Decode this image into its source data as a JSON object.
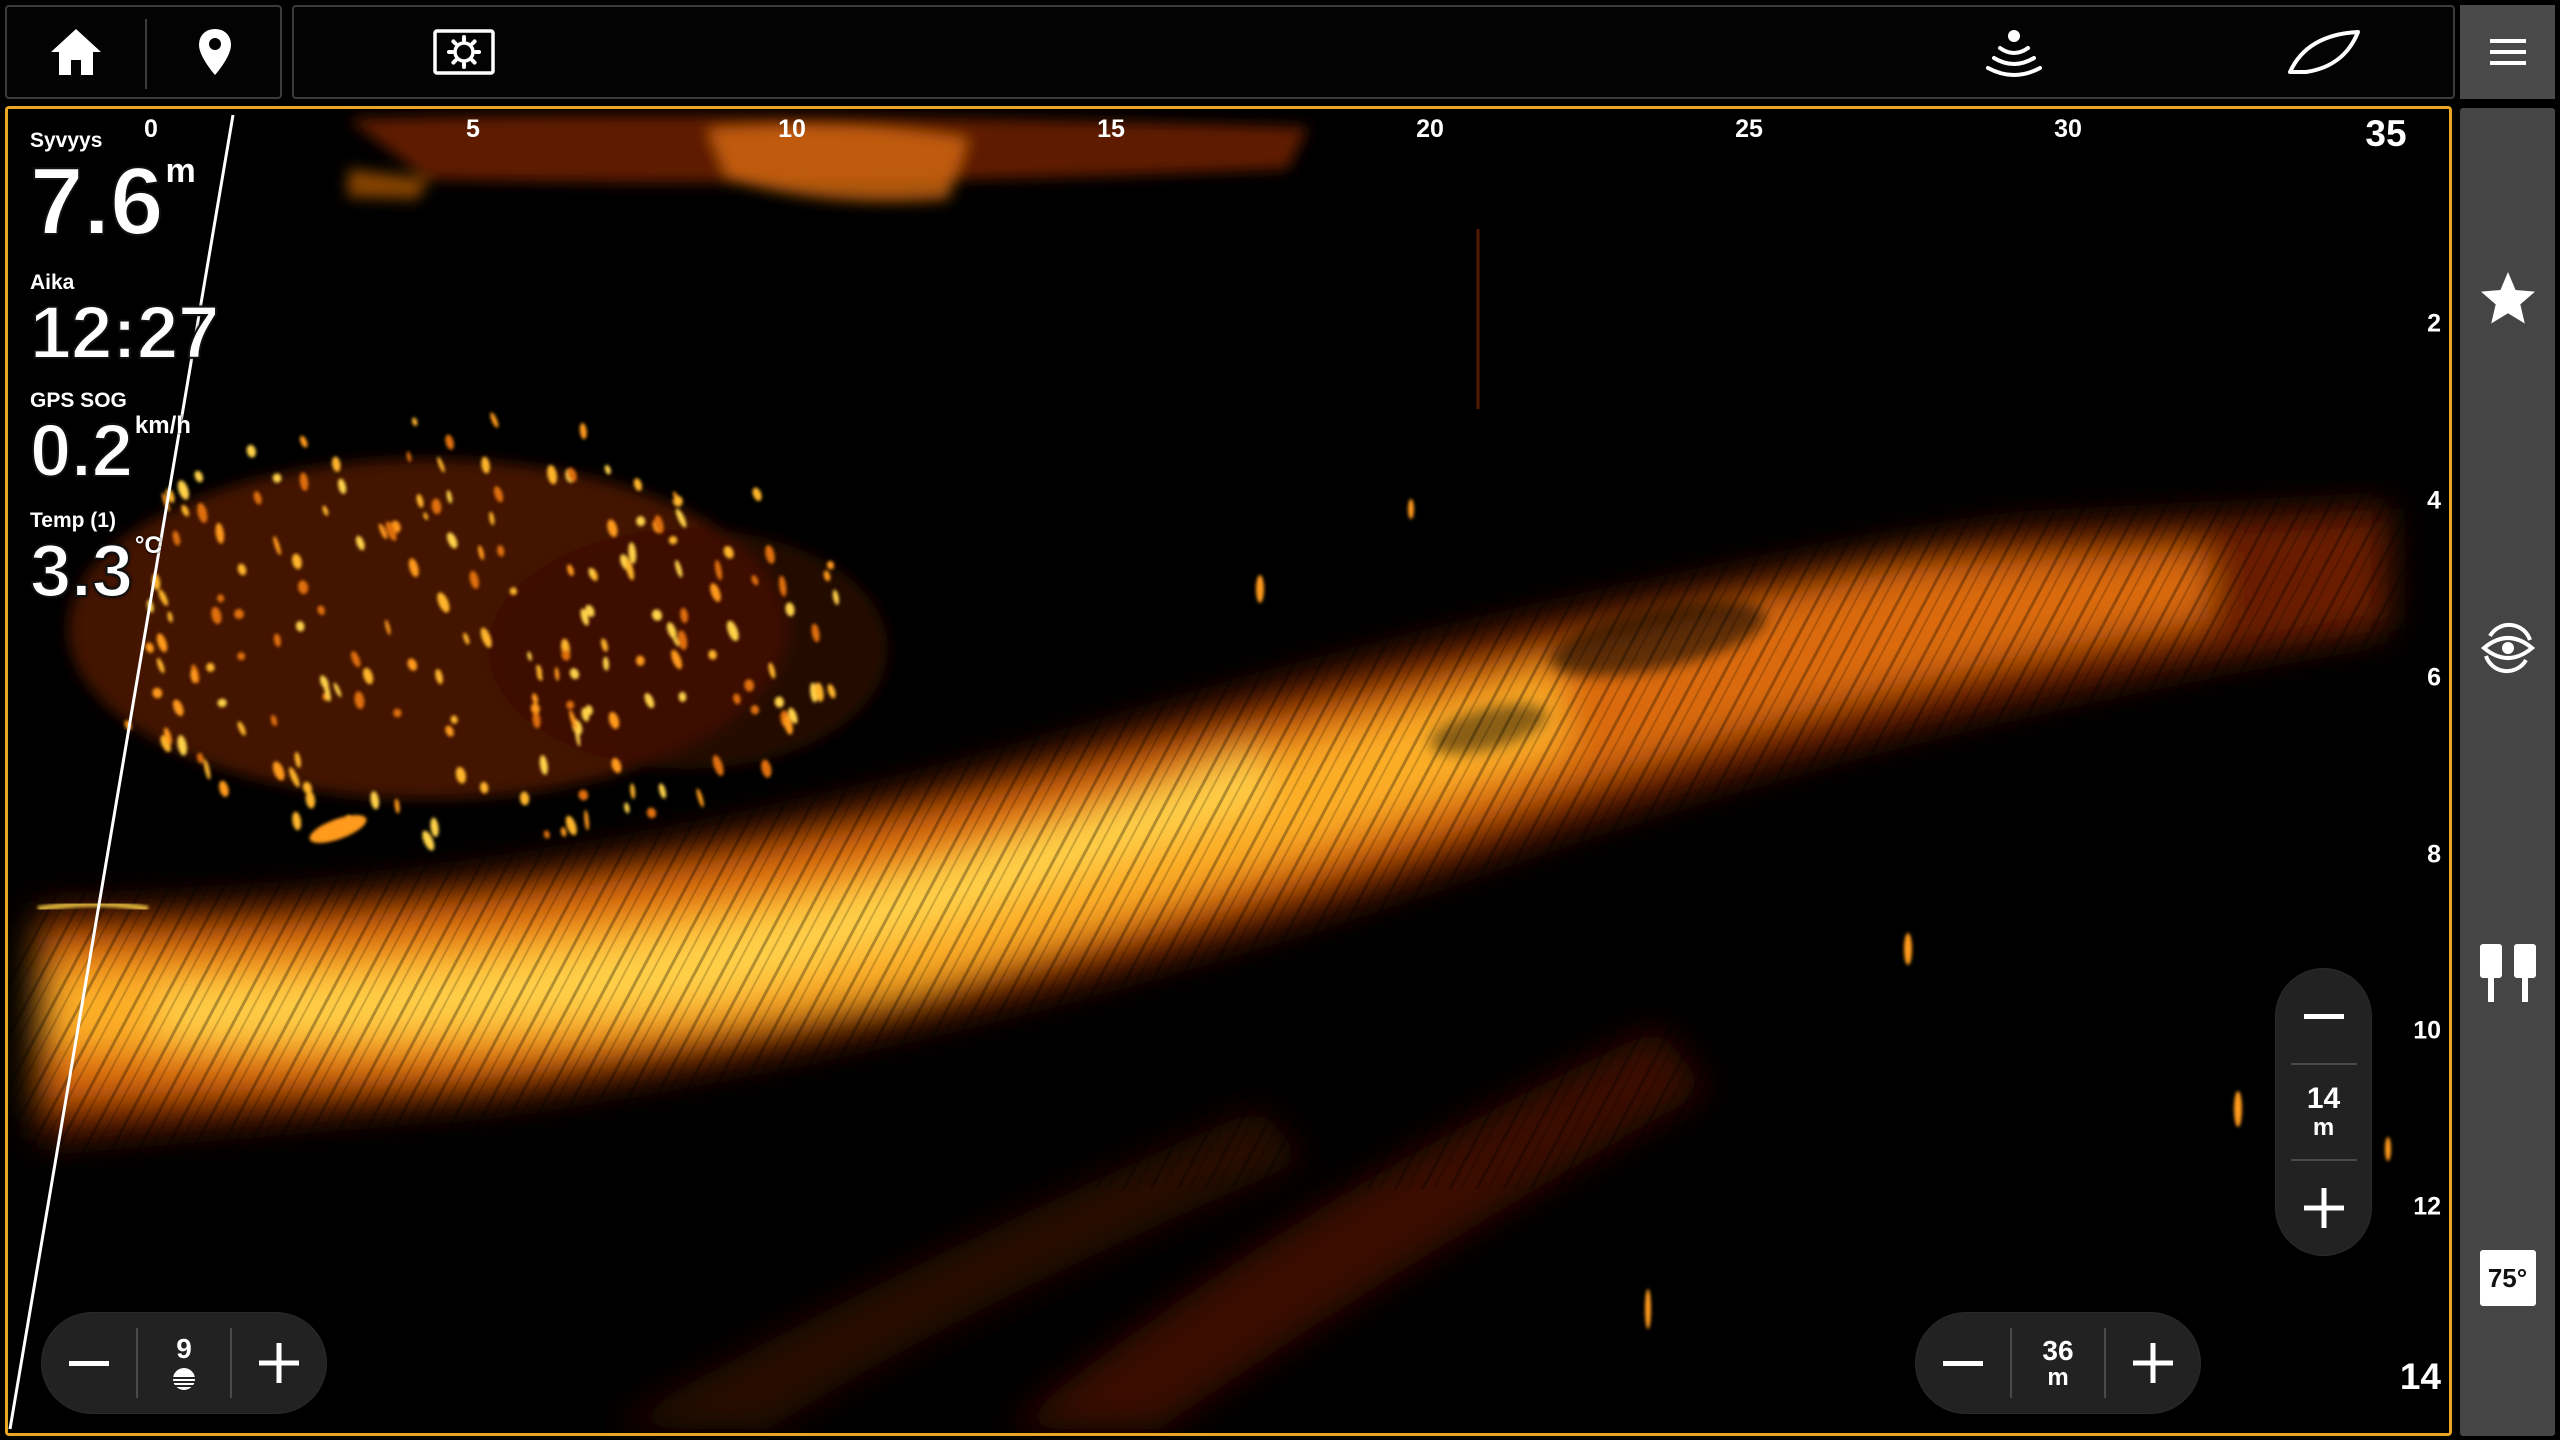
{
  "app": {
    "top_bar": {
      "home_icon": "home-icon",
      "waypoint_icon": "map-pin-icon",
      "screenshot_settings_icon": "camera-settings-icon",
      "sonar_source_icon": "sonar-transducer-icon",
      "boat_icon": "boat-hull-icon",
      "menu_icon": "hamburger-menu-icon"
    },
    "sidebar": {
      "favorite_icon": "star-icon",
      "rotate_view_icon": "eye-rotate-icon",
      "dual_transducer_icon": "transducer-pair-icon",
      "beam_angle_badge": "75°"
    },
    "overlay": {
      "depth": {
        "label": "Syvyys",
        "value": "7.6",
        "unit": "m"
      },
      "time": {
        "label": "Aika",
        "value": "12:27"
      },
      "speed": {
        "label": "GPS SOG",
        "value": "0.2",
        "unit": "km/h"
      },
      "temp": {
        "label": "Temp (1)",
        "value": "3.3",
        "unit": "°C"
      }
    },
    "range_scale": {
      "labels": [
        "0",
        "5",
        "10",
        "15",
        "20",
        "25",
        "30",
        "35"
      ]
    },
    "depth_scale": {
      "labels": [
        "2",
        "4",
        "6",
        "8",
        "10",
        "12",
        "14"
      ]
    },
    "controls": {
      "gain": {
        "value": "9",
        "icon": "brightness-icon",
        "minus": "−",
        "plus": "+"
      },
      "range": {
        "value": "36",
        "unit": "m",
        "minus": "−",
        "plus": "+"
      },
      "depth": {
        "value": "14",
        "unit": "m",
        "minus": "−",
        "plus": "+"
      }
    },
    "colors": {
      "accent_border": "#e9a624",
      "sonar_hot": "#ffd24a",
      "sonar_mid": "#e0700a",
      "sonar_low": "#6a1e00"
    }
  }
}
